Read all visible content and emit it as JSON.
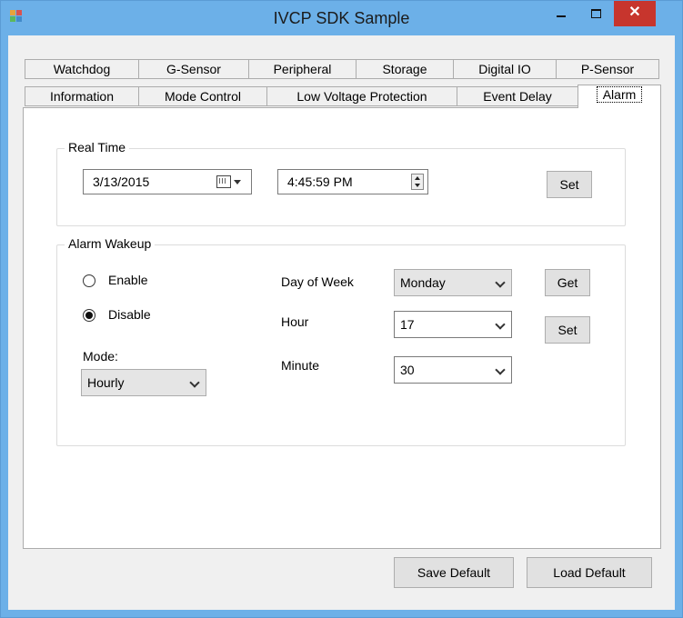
{
  "window": {
    "title": "IVCP SDK Sample",
    "close_glyph": "✕",
    "accent_color": "#6cb0e8",
    "close_color": "#c7352d"
  },
  "tabs": {
    "row1": [
      "Watchdog",
      "G-Sensor",
      "Peripheral",
      "Storage",
      "Digital IO",
      "P-Sensor"
    ],
    "row2": [
      "Information",
      "Mode Control",
      "Low Voltage Protection",
      "Event Delay",
      "Alarm"
    ],
    "selected": "Alarm"
  },
  "real_time": {
    "group_label": "Real Time",
    "date": "3/13/2015",
    "time": "4:45:59 PM",
    "set_label": "Set",
    "calendar_icon": "calendar-icon"
  },
  "alarm_wakeup": {
    "group_label": "Alarm Wakeup",
    "enable_label": "Enable",
    "disable_label": "Disable",
    "selected_option": "Disable",
    "mode_label": "Mode:",
    "mode_value": "Hourly",
    "day_of_week_label": "Day of Week",
    "day_of_week_value": "Monday",
    "hour_label": "Hour",
    "hour_value": "17",
    "minute_label": "Minute",
    "minute_value": "30",
    "get_label": "Get",
    "set_label": "Set"
  },
  "footer": {
    "save_default_label": "Save Default",
    "load_default_label": "Load Default"
  }
}
